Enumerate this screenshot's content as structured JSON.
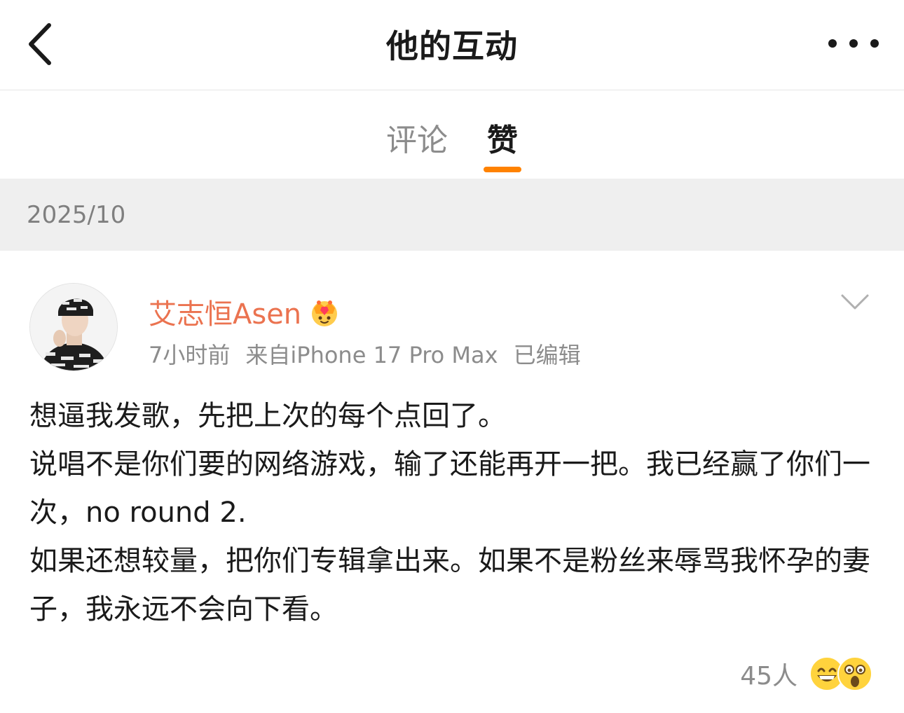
{
  "navbar": {
    "title": "他的互动",
    "back_icon": "chevron-left-icon",
    "more_icon": "more-icon"
  },
  "tabs": [
    {
      "label": "评论",
      "active": false
    },
    {
      "label": "赞",
      "active": true
    }
  ],
  "colors": {
    "accent": "#ff8200",
    "username": "#eb7350",
    "meta_text": "#8c8c8c",
    "date_bar_bg": "#efefef"
  },
  "date_group": "2025/10",
  "post": {
    "username": "艾志恒Asen",
    "badge_icon": "crown-icon",
    "meta": {
      "time": "7小时前",
      "source": "来自iPhone 17 Pro Max",
      "edited": "已编辑"
    },
    "text_lines": [
      "想逼我发歌，先把上次的每个点回了。",
      "说唱不是你们要的网络游戏，输了还能再开一把。我已经赢了你们一次，no round 2.",
      "如果还想较量，把你们专辑拿出来。如果不是粉丝来辱骂我怀孕的妻子，我永远不会向下看。"
    ],
    "reactions": {
      "count": "45人",
      "icons": [
        "grinning-emoji-icon",
        "shocked-emoji-icon"
      ]
    }
  }
}
